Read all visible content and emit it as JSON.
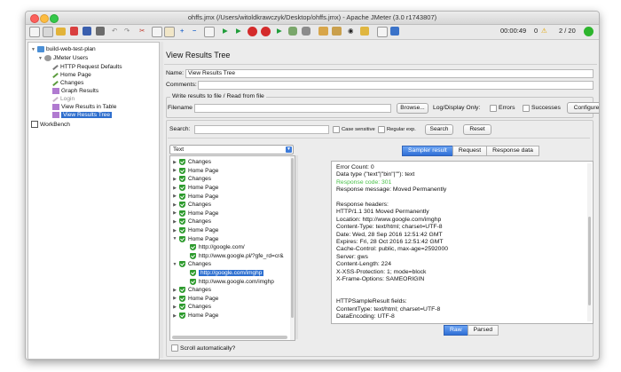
{
  "window": {
    "title": "ohffs.jmx (/Users/witoldkrawczyk/Desktop/ohffs.jmx) - Apache JMeter (3.0 r1743807)"
  },
  "toolbar": {
    "timer": "00:00:49",
    "warnings": "0",
    "threads": "2 / 20"
  },
  "tree": {
    "items": [
      {
        "label": "build-web-test-plan",
        "icon": "test-plan-icon"
      },
      {
        "label": "JMeter Users",
        "icon": "thread-group-icon"
      },
      {
        "label": "HTTP Request Defaults",
        "icon": "config-wrench-icon"
      },
      {
        "label": "Home Page",
        "icon": "sampler-pen-icon"
      },
      {
        "label": "Changes",
        "icon": "sampler-pen-icon"
      },
      {
        "label": "Graph Results",
        "icon": "listener-chart-icon"
      },
      {
        "label": "Login",
        "icon": "sampler-disabled-icon"
      },
      {
        "label": "View Results in Table",
        "icon": "listener-table-icon"
      },
      {
        "label": "View Results Tree",
        "icon": "listener-tree-icon"
      },
      {
        "label": "WorkBench",
        "icon": "workbench-icon"
      }
    ]
  },
  "panel": {
    "title": "View Results Tree",
    "name_label": "Name:",
    "name_value": "View Results Tree",
    "comments_label": "Comments:",
    "comments_value": "",
    "file_group_label": "Write results to file / Read from file",
    "filename_label": "Filename",
    "filename_value": "",
    "browse_label": "Browse...",
    "log_display_label": "Log/Display Only:",
    "errors_label": "Errors",
    "successes_label": "Successes",
    "configure_label": "Configure",
    "search_label": "Search:",
    "search_value": "",
    "case_sensitive_label": "Case sensitive",
    "regular_exp_label": "Regular exp.",
    "search_button": "Search",
    "reset_button": "Reset",
    "renderer_value": "Text",
    "scroll_auto_label": "Scroll automatically?"
  },
  "results": [
    {
      "label": "Changes",
      "indent": 0,
      "expand": "▶"
    },
    {
      "label": "Home Page",
      "indent": 0,
      "expand": "▶"
    },
    {
      "label": "Changes",
      "indent": 0,
      "expand": "▶"
    },
    {
      "label": "Home Page",
      "indent": 0,
      "expand": "▶"
    },
    {
      "label": "Home Page",
      "indent": 0,
      "expand": "▶"
    },
    {
      "label": "Changes",
      "indent": 0,
      "expand": "▶"
    },
    {
      "label": "Home Page",
      "indent": 0,
      "expand": "▶"
    },
    {
      "label": "Changes",
      "indent": 0,
      "expand": "▶"
    },
    {
      "label": "Home Page",
      "indent": 0,
      "expand": "▶"
    },
    {
      "label": "Home Page",
      "indent": 0,
      "expand": "▼"
    },
    {
      "label": "http://google.com/",
      "indent": 1,
      "expand": ""
    },
    {
      "label": "http://www.google.pl/?gfe_rd=cr&",
      "indent": 1,
      "expand": ""
    },
    {
      "label": "Changes",
      "indent": 0,
      "expand": "▼"
    },
    {
      "label": "http://google.com/imghp",
      "indent": 1,
      "expand": "",
      "selected": true
    },
    {
      "label": "http://www.google.com/imghp",
      "indent": 1,
      "expand": ""
    },
    {
      "label": "Changes",
      "indent": 0,
      "expand": "▶"
    },
    {
      "label": "Home Page",
      "indent": 0,
      "expand": "▶"
    },
    {
      "label": "Changes",
      "indent": 0,
      "expand": "▶"
    },
    {
      "label": "Home Page",
      "indent": 0,
      "expand": "▶"
    }
  ],
  "tabs": {
    "sampler_result": "Sampler result",
    "request": "Request",
    "response_data": "Response data"
  },
  "response_lines": [
    {
      "text": "Error Count: 0",
      "cls": ""
    },
    {
      "text": "Data type (\"text\"|\"bin\"|\"\"): text",
      "cls": ""
    },
    {
      "text": "Response code: 301",
      "cls": "green"
    },
    {
      "text": "Response message: Moved Permanently",
      "cls": ""
    },
    {
      "text": "",
      "cls": ""
    },
    {
      "text": "Response headers:",
      "cls": ""
    },
    {
      "text": "HTTP/1.1 301 Moved Permanently",
      "cls": ""
    },
    {
      "text": "Location: http://www.google.com/imghp",
      "cls": ""
    },
    {
      "text": "Content-Type: text/html; charset=UTF-8",
      "cls": ""
    },
    {
      "text": "Date: Wed, 28 Sep 2016 12:51:42 GMT",
      "cls": ""
    },
    {
      "text": "Expires: Fri, 28 Oct 2016 12:51:42 GMT",
      "cls": ""
    },
    {
      "text": "Cache-Control: public, max-age=2592000",
      "cls": ""
    },
    {
      "text": "Server: gws",
      "cls": ""
    },
    {
      "text": "Content-Length: 224",
      "cls": ""
    },
    {
      "text": "X-XSS-Protection: 1; mode=block",
      "cls": ""
    },
    {
      "text": "X-Frame-Options: SAMEORIGIN",
      "cls": ""
    },
    {
      "text": "",
      "cls": ""
    },
    {
      "text": "",
      "cls": ""
    },
    {
      "text": "HTTPSampleResult fields:",
      "cls": ""
    },
    {
      "text": "ContentType: text/html; charset=UTF-8",
      "cls": ""
    },
    {
      "text": "DataEncoding: UTF-8",
      "cls": ""
    }
  ],
  "view_toggle": {
    "raw": "Raw",
    "parsed": "Parsed"
  }
}
